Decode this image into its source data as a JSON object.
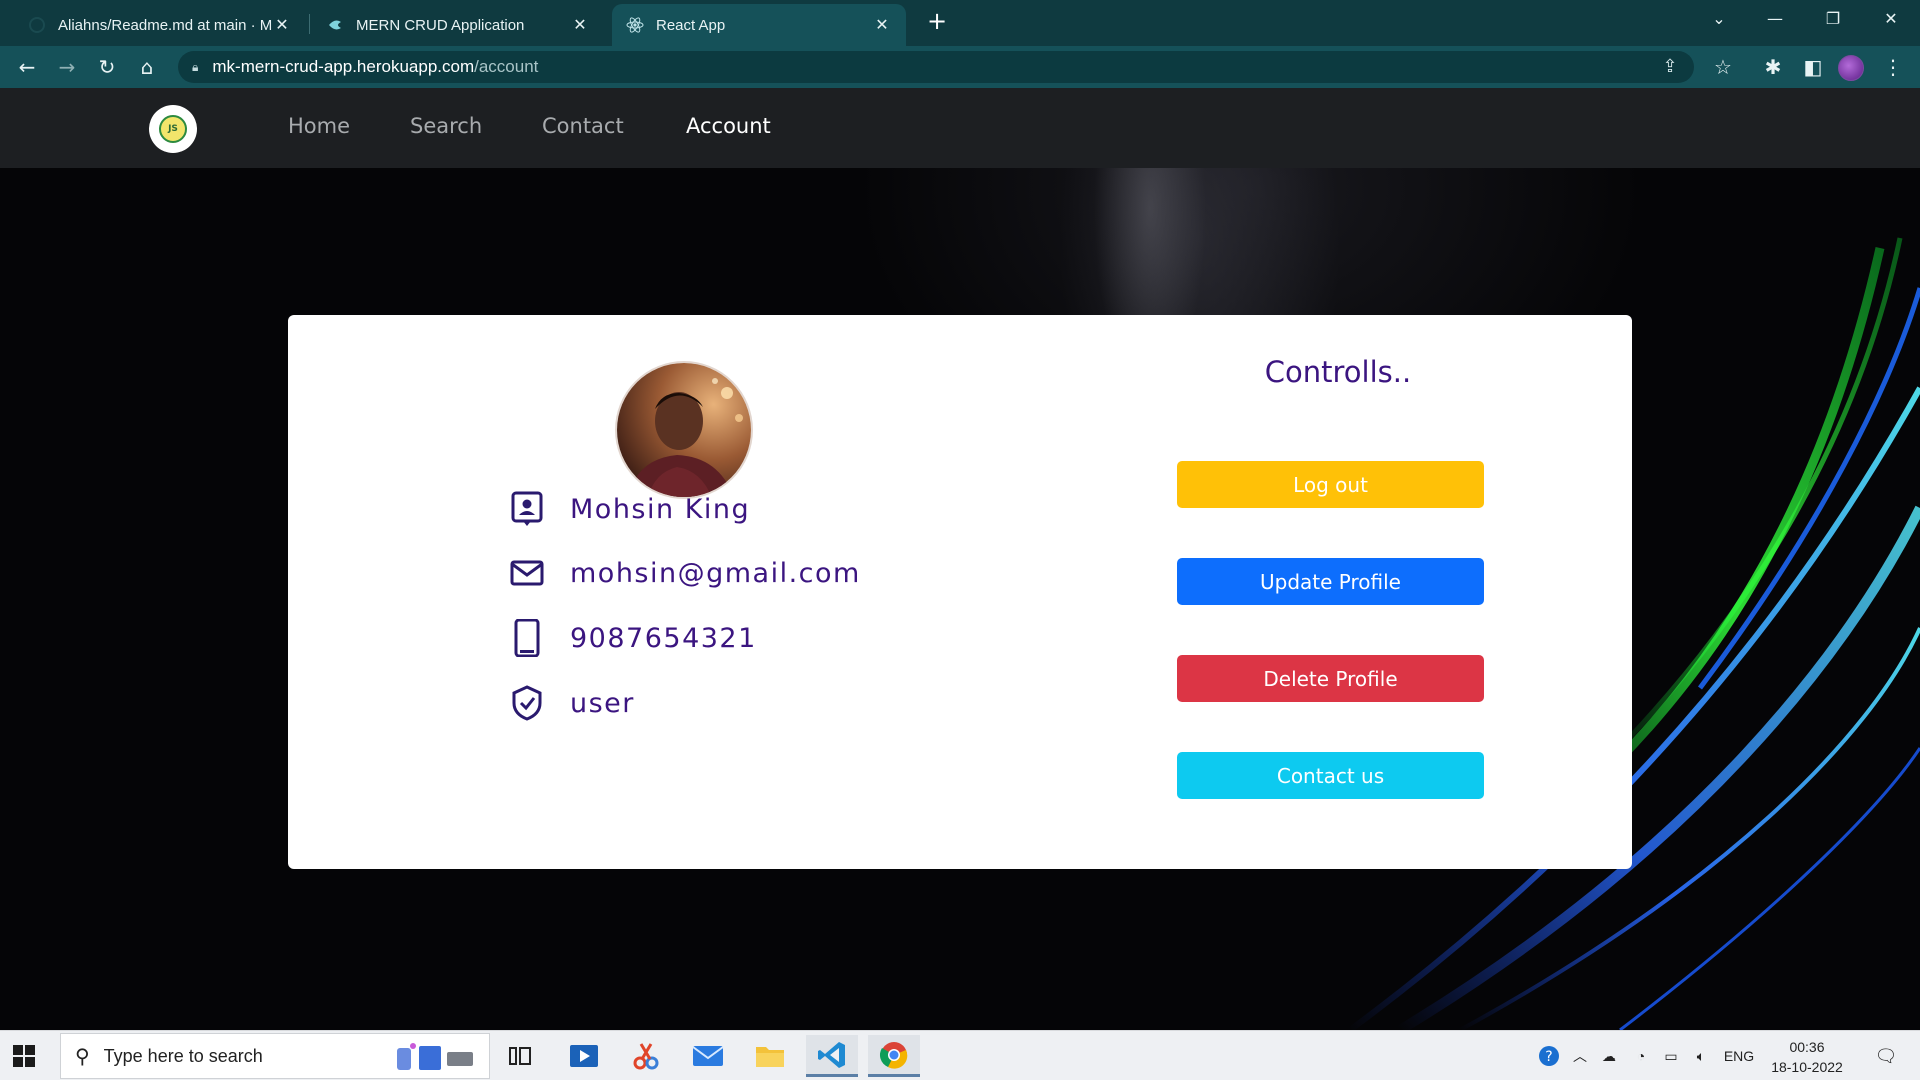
{
  "browser": {
    "tabs": [
      {
        "title": "Aliahns/Readme.md at main · Mc",
        "icon": "github-icon"
      },
      {
        "title": "MERN CRUD Application",
        "icon": "chakra-icon"
      },
      {
        "title": "React App",
        "icon": "react-icon"
      }
    ],
    "url_host": "mk-mern-crud-app.herokuapp.com",
    "url_path": "/account"
  },
  "nav": {
    "links": [
      "Home",
      "Search",
      "Contact",
      "Account"
    ],
    "active": "Account",
    "logo_text": "JS"
  },
  "profile": {
    "name": "Mohsin King",
    "email": "mohsin@gmail.com",
    "phone": "9087654321",
    "role": "user"
  },
  "controls": {
    "title": "Controlls..",
    "logout": "Log out",
    "update": "Update Profile",
    "delete": "Delete Profile",
    "contact": "Contact us"
  },
  "colors": {
    "accent_text": "#3b1580",
    "logout": "#ffc107",
    "update": "#0d6efd",
    "delete": "#dc3545",
    "contact": "#0dcaf0",
    "navbar": "#1d1f22",
    "chrome_tabstrip": "#0f3a40"
  },
  "taskbar": {
    "search_placeholder": "Type here to search",
    "language": "ENG",
    "time": "00:36",
    "date": "18-10-2022"
  }
}
